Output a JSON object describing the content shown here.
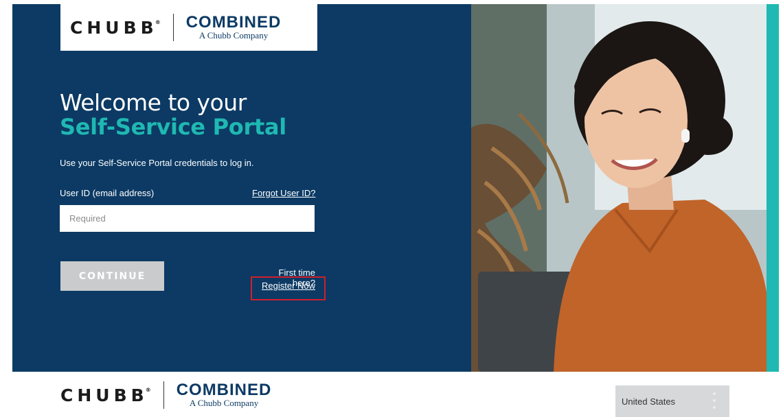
{
  "header": {
    "logo_chubb": "CHUBB",
    "logo_combined": "COMBINED",
    "logo_tagline": "A Chubb Company"
  },
  "hero": {
    "welcome": "Welcome to your",
    "portal_title": "Self-Service Portal",
    "instructions": "Use your Self-Service Portal credentials to log in."
  },
  "login": {
    "userid_label": "User ID (email address)",
    "forgot_link": "Forgot User ID?",
    "userid_placeholder": "Required",
    "userid_value": "",
    "continue_label": "CONTINUE",
    "first_time": "First time here?",
    "register_link": "Register Now"
  },
  "footer": {
    "logo_chubb": "CHUBB",
    "logo_combined": "COMBINED",
    "logo_tagline": "A Chubb Company",
    "country": "United States"
  },
  "colors": {
    "navy": "#0c3a64",
    "teal": "#1fb8b2",
    "button_disabled": "#c9cbcd",
    "highlight_red": "#d11f2a"
  },
  "icons": {
    "country_menu": "kebab-dots-icon",
    "hero_image": "woman-with-laptop-photo"
  }
}
